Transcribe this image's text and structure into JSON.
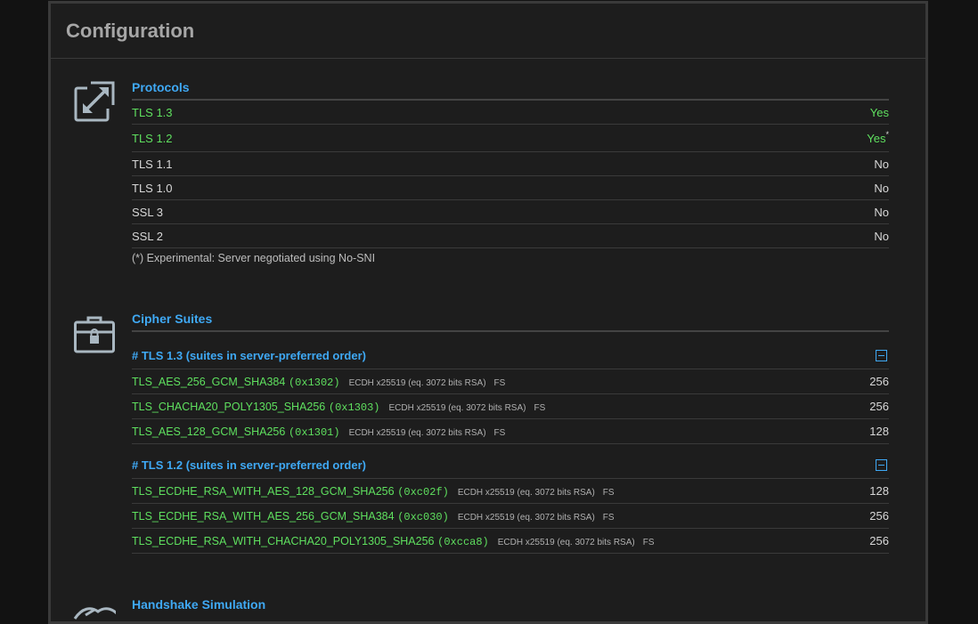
{
  "header": {
    "title": "Configuration"
  },
  "protocols": {
    "title": "Protocols",
    "icon": "expand-arrows-icon",
    "rows": [
      {
        "name": "TLS 1.3",
        "value": "Yes",
        "supported": true,
        "note": ""
      },
      {
        "name": "TLS 1.2",
        "value": "Yes",
        "supported": true,
        "note": "*"
      },
      {
        "name": "TLS 1.1",
        "value": "No",
        "supported": false,
        "note": ""
      },
      {
        "name": "TLS 1.0",
        "value": "No",
        "supported": false,
        "note": ""
      },
      {
        "name": "SSL 3",
        "value": "No",
        "supported": false,
        "note": ""
      },
      {
        "name": "SSL 2",
        "value": "No",
        "supported": false,
        "note": ""
      }
    ],
    "footnote": "(*) Experimental: Server negotiated using No-SNI"
  },
  "cipher_suites": {
    "title": "Cipher Suites",
    "icon": "briefcase-lock-icon",
    "groups": [
      {
        "title": "# TLS 1.3 (suites in server-preferred order)",
        "suites": [
          {
            "name": "TLS_AES_256_GCM_SHA384",
            "hex": "(0x1302)",
            "detail": "ECDH x25519 (eq. 3072 bits RSA)",
            "fs": "FS",
            "bits": "256"
          },
          {
            "name": "TLS_CHACHA20_POLY1305_SHA256",
            "hex": "(0x1303)",
            "detail": "ECDH x25519 (eq. 3072 bits RSA)",
            "fs": "FS",
            "bits": "256"
          },
          {
            "name": "TLS_AES_128_GCM_SHA256",
            "hex": "(0x1301)",
            "detail": "ECDH x25519 (eq. 3072 bits RSA)",
            "fs": "FS",
            "bits": "128"
          }
        ]
      },
      {
        "title": "# TLS 1.2 (suites in server-preferred order)",
        "suites": [
          {
            "name": "TLS_ECDHE_RSA_WITH_AES_128_GCM_SHA256",
            "hex": "(0xc02f)",
            "detail": "ECDH x25519 (eq. 3072 bits RSA)",
            "fs": "FS",
            "bits": "128"
          },
          {
            "name": "TLS_ECDHE_RSA_WITH_AES_256_GCM_SHA384",
            "hex": "(0xc030)",
            "detail": "ECDH x25519 (eq. 3072 bits RSA)",
            "fs": "FS",
            "bits": "256"
          },
          {
            "name": "TLS_ECDHE_RSA_WITH_CHACHA20_POLY1305_SHA256",
            "hex": "(0xcca8)",
            "detail": "ECDH x25519 (eq. 3072 bits RSA)",
            "fs": "FS",
            "bits": "256"
          }
        ]
      }
    ]
  },
  "handshake": {
    "title": "Handshake Simulation",
    "icon": "handshake-icon"
  },
  "colors": {
    "accent": "#3fa9f5",
    "supported": "#5fe05f",
    "background": "#1d1d1d"
  }
}
